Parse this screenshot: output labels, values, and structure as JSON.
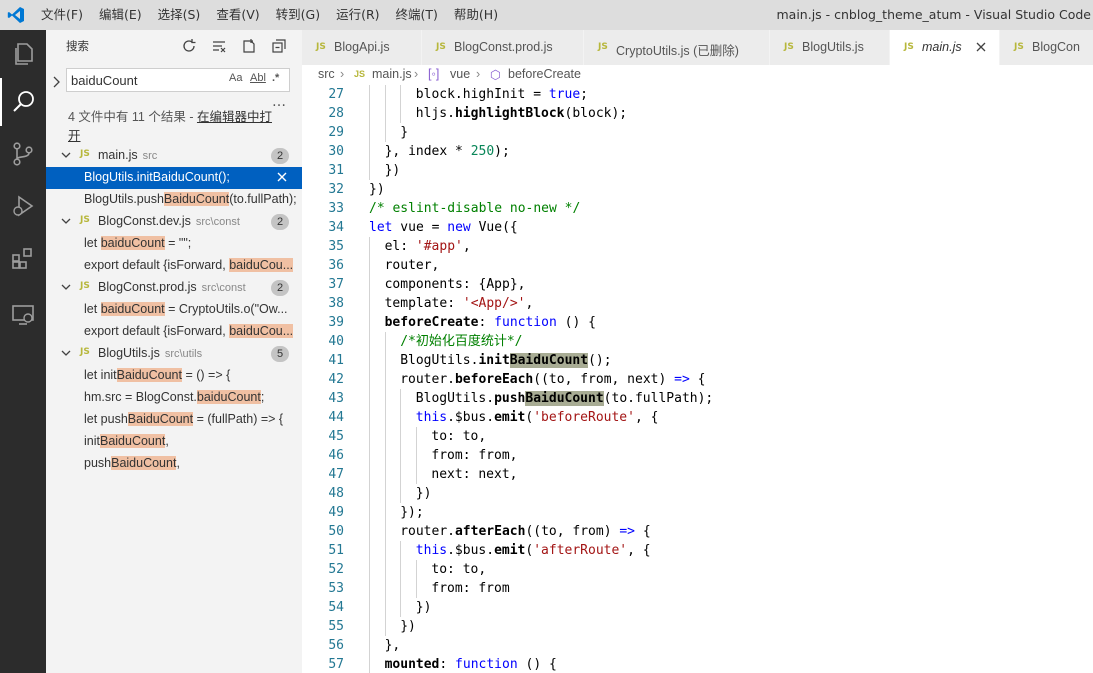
{
  "titlebar": {
    "menus": [
      "文件(F)",
      "编辑(E)",
      "选择(S)",
      "查看(V)",
      "转到(G)",
      "运行(R)",
      "终端(T)",
      "帮助(H)"
    ],
    "title": "main.js - cnblog_theme_atum - Visual Studio Code"
  },
  "activitybar": {
    "items": [
      "explorer-icon",
      "search-icon",
      "source-control-icon",
      "run-debug-icon",
      "extensions-icon",
      "remote-explorer-icon"
    ],
    "active": "search-icon"
  },
  "sidebar": {
    "title": "搜索",
    "search": {
      "value": "baiduCount",
      "opt_case": "Aa",
      "opt_word": "Abl",
      "opt_regex": ".*"
    },
    "summary_prefix": "4 文件中有 11 个结果 - ",
    "summary_link": "在编辑器中打开",
    "results": [
      {
        "file": "main.js",
        "path": "src",
        "count": "2",
        "matches": [
          {
            "pre": "BlogUtils.init",
            "hl": "BaiduCount",
            "post": "();",
            "selected": true
          },
          {
            "pre": "BlogUtils.push",
            "hl": "BaiduCount",
            "post": "(to.fullPath);"
          }
        ]
      },
      {
        "file": "BlogConst.dev.js",
        "path": "src\\const",
        "count": "2",
        "matches": [
          {
            "pre": "let ",
            "hl": "baiduCount",
            "post": " = \"\";"
          },
          {
            "pre": "export default {isForward, ",
            "hl": "baiduCou...",
            "post": ""
          }
        ]
      },
      {
        "file": "BlogConst.prod.js",
        "path": "src\\const",
        "count": "2",
        "matches": [
          {
            "pre": "let ",
            "hl": "baiduCount",
            "post": " = CryptoUtils.o(\"Ow..."
          },
          {
            "pre": "export default {isForward, ",
            "hl": "baiduCou...",
            "post": ""
          }
        ]
      },
      {
        "file": "BlogUtils.js",
        "path": "src\\utils",
        "count": "5",
        "matches": [
          {
            "pre": "let init",
            "hl": "BaiduCount",
            "post": " = () => {"
          },
          {
            "pre": "hm.src = BlogConst.",
            "hl": "baiduCount",
            "post": ";"
          },
          {
            "pre": "let push",
            "hl": "BaiduCount",
            "post": " = (fullPath) => {"
          },
          {
            "pre": "init",
            "hl": "BaiduCount",
            "post": ","
          },
          {
            "pre": "push",
            "hl": "BaiduCount",
            "post": ","
          }
        ]
      }
    ]
  },
  "tabs": [
    {
      "label": "BlogApi.js"
    },
    {
      "label": "BlogConst.prod.js"
    },
    {
      "label": "CryptoUtils.js (已删除)"
    },
    {
      "label": "BlogUtils.js"
    },
    {
      "label": "main.js",
      "active": true
    },
    {
      "label": "BlogCon"
    }
  ],
  "breadcrumb": {
    "folder": "src",
    "file": "main.js",
    "symbol1": "vue",
    "symbol2": "beforeCreate"
  },
  "editor": {
    "first_line": 27,
    "lines": [
      {
        "i": 3,
        "t": [
          [
            "block.highInit = ",
            ""
          ],
          [
            "true",
            "kc"
          ],
          [
            ";",
            ""
          ]
        ]
      },
      {
        "i": 3,
        "t": [
          [
            "hljs.",
            ""
          ],
          [
            "highlightBlock",
            "fn"
          ],
          [
            "(block);",
            ""
          ]
        ]
      },
      {
        "i": 2,
        "t": [
          [
            "}",
            ""
          ]
        ]
      },
      {
        "i": 1,
        "t": [
          [
            "}, index * ",
            ""
          ],
          [
            "250",
            "nm"
          ],
          [
            ");",
            ""
          ]
        ]
      },
      {
        "i": 1,
        "t": [
          [
            "})",
            ""
          ]
        ]
      },
      {
        "i": 0,
        "t": [
          [
            "})",
            ""
          ]
        ]
      },
      {
        "i": 0,
        "t": [
          [
            "/* eslint-disable no-new */",
            "cm"
          ]
        ]
      },
      {
        "i": 0,
        "t": [
          [
            "let",
            "kw"
          ],
          [
            " vue = ",
            ""
          ],
          [
            "new",
            "kw"
          ],
          [
            " Vue({",
            ""
          ]
        ]
      },
      {
        "i": 1,
        "t": [
          [
            "el: ",
            ""
          ],
          [
            "'#app'",
            "st"
          ],
          [
            ",",
            ""
          ]
        ]
      },
      {
        "i": 1,
        "t": [
          [
            "router,",
            ""
          ]
        ]
      },
      {
        "i": 1,
        "t": [
          [
            "components: {App},",
            ""
          ]
        ]
      },
      {
        "i": 1,
        "t": [
          [
            "template: ",
            ""
          ],
          [
            "'<App/>'",
            "st"
          ],
          [
            ",",
            ""
          ]
        ]
      },
      {
        "i": 1,
        "t": [
          [
            "beforeCreate",
            "fn"
          ],
          [
            ": ",
            ""
          ],
          [
            "function",
            "kw"
          ],
          [
            " () {",
            ""
          ]
        ]
      },
      {
        "i": 2,
        "t": [
          [
            "/*初始化百度统计*/",
            "cm"
          ]
        ]
      },
      {
        "i": 2,
        "t": [
          [
            "BlogUtils.",
            ""
          ],
          [
            "init",
            "fn"
          ],
          [
            "BaiduCount",
            "fn hlw"
          ],
          [
            "();",
            ""
          ]
        ]
      },
      {
        "i": 2,
        "t": [
          [
            "router.",
            ""
          ],
          [
            "beforeEach",
            "fn"
          ],
          [
            "((to, from, next) ",
            ""
          ],
          [
            "=>",
            "kw"
          ],
          [
            " {",
            ""
          ]
        ]
      },
      {
        "i": 3,
        "t": [
          [
            "BlogUtils.",
            ""
          ],
          [
            "push",
            "fn"
          ],
          [
            "BaiduCount",
            "fn hlw"
          ],
          [
            "(to.fullPath);",
            ""
          ]
        ]
      },
      {
        "i": 3,
        "t": [
          [
            "this",
            "kw"
          ],
          [
            ".$bus.",
            ""
          ],
          [
            "emit",
            "fn"
          ],
          [
            "(",
            ""
          ],
          [
            "'beforeRoute'",
            "st"
          ],
          [
            ", {",
            ""
          ]
        ]
      },
      {
        "i": 4,
        "t": [
          [
            "to: to,",
            ""
          ]
        ]
      },
      {
        "i": 4,
        "t": [
          [
            "from: from,",
            ""
          ]
        ]
      },
      {
        "i": 4,
        "t": [
          [
            "next: next,",
            ""
          ]
        ]
      },
      {
        "i": 3,
        "t": [
          [
            "})",
            ""
          ]
        ]
      },
      {
        "i": 2,
        "t": [
          [
            "});",
            ""
          ]
        ]
      },
      {
        "i": 2,
        "t": [
          [
            "router.",
            ""
          ],
          [
            "afterEach",
            "fn"
          ],
          [
            "((to, from) ",
            ""
          ],
          [
            "=>",
            "kw"
          ],
          [
            " {",
            ""
          ]
        ]
      },
      {
        "i": 3,
        "t": [
          [
            "this",
            "kw"
          ],
          [
            ".$bus.",
            ""
          ],
          [
            "emit",
            "fn"
          ],
          [
            "(",
            ""
          ],
          [
            "'afterRoute'",
            "st"
          ],
          [
            ", {",
            ""
          ]
        ]
      },
      {
        "i": 4,
        "t": [
          [
            "to: to,",
            ""
          ]
        ]
      },
      {
        "i": 4,
        "t": [
          [
            "from: from",
            ""
          ]
        ]
      },
      {
        "i": 3,
        "t": [
          [
            "})",
            ""
          ]
        ]
      },
      {
        "i": 2,
        "t": [
          [
            "})",
            ""
          ]
        ]
      },
      {
        "i": 1,
        "t": [
          [
            "},",
            ""
          ]
        ]
      },
      {
        "i": 1,
        "t": [
          [
            "mounted",
            "fn"
          ],
          [
            ": ",
            ""
          ],
          [
            "function",
            "kw"
          ],
          [
            " () {",
            ""
          ]
        ]
      }
    ]
  },
  "colors": {
    "activity_bg": "#2c2c2c",
    "sidebar_bg": "#f3f3f3",
    "selection": "#0060c0",
    "match_highlight": "#f0c0a3",
    "js_icon": "#b7b73b"
  }
}
